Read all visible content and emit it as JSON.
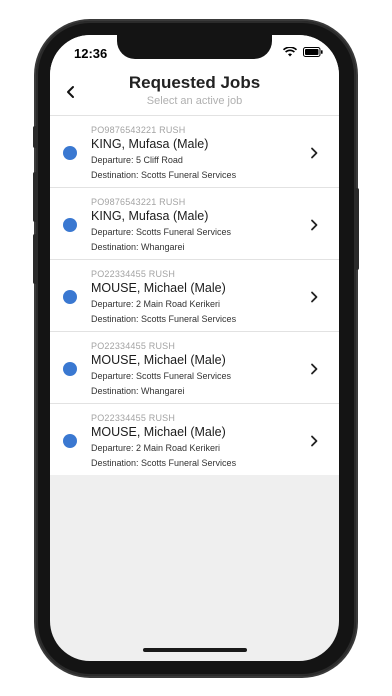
{
  "status_bar": {
    "time": "12:36"
  },
  "header": {
    "title": "Requested Jobs",
    "subtitle": "Select an active job"
  },
  "icons": {
    "back": "chevron-left-icon",
    "row_arrow": "chevron-right-icon"
  },
  "colors": {
    "status_dot": "#3a78d1"
  },
  "jobs": [
    {
      "po": "PO9876543221 RUSH",
      "name": "KING, Mufasa (Male)",
      "departure": "Departure: 5 Cliff Road",
      "destination": "Destination: Scotts Funeral Services"
    },
    {
      "po": "PO9876543221 RUSH",
      "name": "KING, Mufasa (Male)",
      "departure": "Departure: Scotts Funeral Services",
      "destination": "Destination: Whangarei"
    },
    {
      "po": "PO22334455 RUSH",
      "name": "MOUSE, Michael (Male)",
      "departure": "Departure: 2 Main Road Kerikeri",
      "destination": "Destination: Scotts Funeral Services"
    },
    {
      "po": "PO22334455 RUSH",
      "name": "MOUSE, Michael (Male)",
      "departure": "Departure: Scotts Funeral Services",
      "destination": "Destination: Whangarei"
    },
    {
      "po": "PO22334455 RUSH",
      "name": "MOUSE, Michael (Male)",
      "departure": "Departure: 2 Main Road Kerikeri",
      "destination": "Destination: Scotts Funeral Services"
    }
  ]
}
